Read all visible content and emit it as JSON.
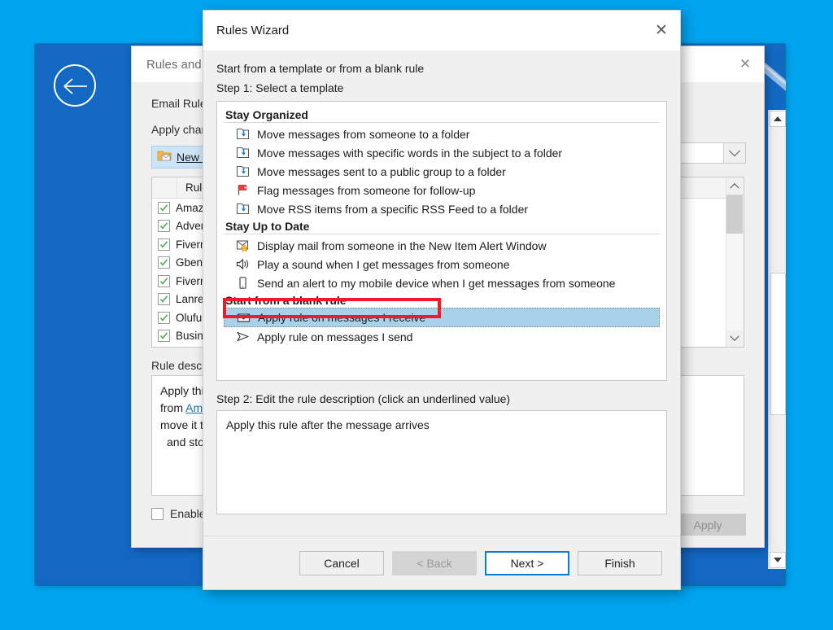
{
  "desktop": {
    "background_color": "#00a4ef",
    "backstage_color": "#1268c3",
    "back_button_icon": "back-arrow-icon"
  },
  "rules_and_alerts": {
    "title": "Rules and A",
    "close_label": "✕",
    "tab_label": "Email Rules",
    "apply_changes_label": "Apply chan",
    "account_dropdown_value": "",
    "new_rule_button": "New Ru",
    "list_header": "Rule (a",
    "rules": [
      {
        "name": "Amazo",
        "checked": true
      },
      {
        "name": "Advert",
        "checked": true
      },
      {
        "name": "Fiverr",
        "checked": true
      },
      {
        "name": "Gbeng",
        "checked": true
      },
      {
        "name": "Fiverr",
        "checked": true
      },
      {
        "name": "Lanre ",
        "checked": true
      },
      {
        "name": "Olufun",
        "checked": true
      },
      {
        "name": "Busine",
        "checked": true
      }
    ],
    "rule_description_label": "Rule descrip",
    "rule_description_lines": [
      "Apply this",
      "from Ama",
      "move it to",
      "and stop"
    ],
    "rule_description_link": "Ama",
    "enable_rule_label": "Enable r",
    "apply_button": "Apply"
  },
  "wizard": {
    "title": "Rules Wizard",
    "close_label": "✕",
    "intro": "Start from a template or from a blank rule",
    "step1_label": "Step 1: Select a template",
    "groups": [
      {
        "heading": "Stay Organized",
        "items": [
          {
            "label": "Move messages from someone to a folder",
            "icon": "move-to-folder-icon",
            "selected": false
          },
          {
            "label": "Move messages with specific words in the subject to a folder",
            "icon": "move-to-folder-icon",
            "selected": false
          },
          {
            "label": "Move messages sent to a public group to a folder",
            "icon": "move-to-folder-icon",
            "selected": false
          },
          {
            "label": "Flag messages from someone for follow-up",
            "icon": "flag-icon",
            "selected": false
          },
          {
            "label": "Move RSS items from a specific RSS Feed to a folder",
            "icon": "move-to-folder-icon",
            "selected": false
          }
        ]
      },
      {
        "heading": "Stay Up to Date",
        "items": [
          {
            "label": "Display mail from someone in the New Item Alert Window",
            "icon": "alert-window-icon",
            "selected": false
          },
          {
            "label": "Play a sound when I get messages from someone",
            "icon": "speaker-icon",
            "selected": false
          },
          {
            "label": "Send an alert to my mobile device when I get messages from someone",
            "icon": "mobile-device-icon",
            "selected": false
          }
        ]
      },
      {
        "heading": "Start from a blank rule",
        "items": [
          {
            "label": "Apply rule on messages I receive",
            "icon": "envelope-icon",
            "selected": true
          },
          {
            "label": "Apply rule on messages I send",
            "icon": "send-icon",
            "selected": false
          }
        ]
      }
    ],
    "step2_label": "Step 2: Edit the rule description (click an underlined value)",
    "description_text": "Apply this rule after the message arrives",
    "buttons": {
      "cancel": "Cancel",
      "back": "< Back",
      "next": "Next >",
      "finish": "Finish"
    }
  },
  "annotation": {
    "color": "#ee1c24",
    "target": "Apply rule on messages I receive"
  }
}
